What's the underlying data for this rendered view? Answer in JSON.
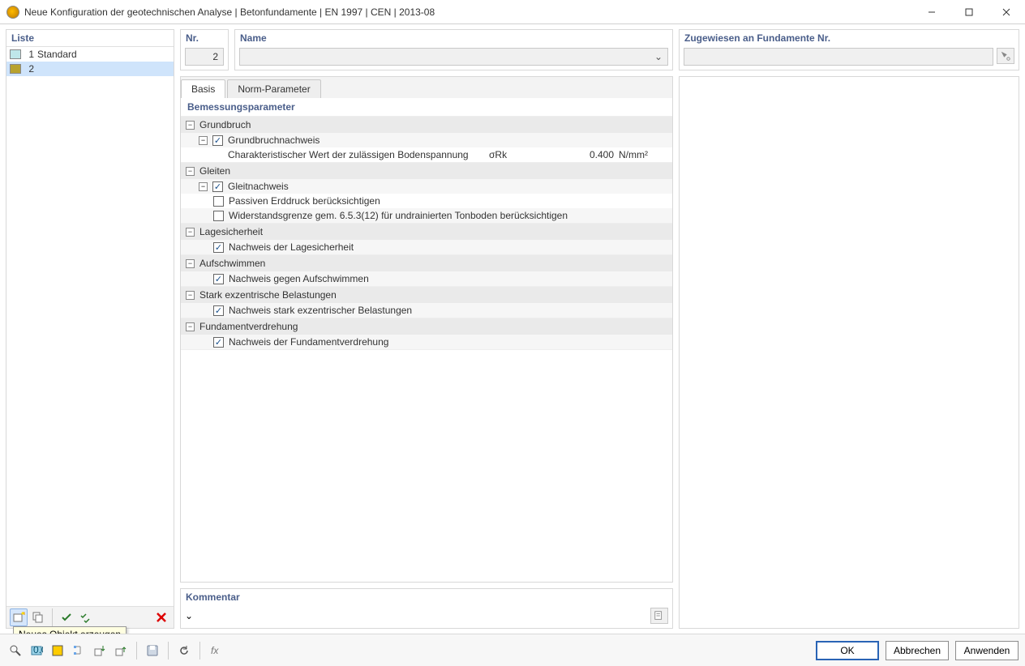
{
  "window": {
    "title": "Neue Konfiguration der geotechnischen Analyse | Betonfundamente | EN 1997 | CEN | 2013-08"
  },
  "list": {
    "header": "Liste",
    "items": [
      {
        "num": "1",
        "name": "Standard",
        "color": "#bfe7ea"
      },
      {
        "num": "2",
        "name": "",
        "color": "#b8a22e"
      }
    ]
  },
  "tooltip": "Neues Objekt erzeugen",
  "fields": {
    "nr_label": "Nr.",
    "nr_value": "2",
    "name_label": "Name",
    "name_value": "",
    "assigned_label": "Zugewiesen an Fundamente Nr.",
    "assigned_value": ""
  },
  "tabs": {
    "basis": "Basis",
    "norm": "Norm-Parameter"
  },
  "params": {
    "header": "Bemessungsparameter",
    "groups": [
      {
        "title": "Grundbruch",
        "items": [
          {
            "type": "check",
            "checked": true,
            "label": "Grundbruchnachweis",
            "hasSub": true
          },
          {
            "type": "value",
            "desc": "Charakteristischer Wert der zulässigen Bodenspannung",
            "sym": "σRk",
            "val": "0.400",
            "unit": "N/mm²"
          }
        ]
      },
      {
        "title": "Gleiten",
        "items": [
          {
            "type": "check",
            "checked": true,
            "label": "Gleitnachweis",
            "hasSub": true
          },
          {
            "type": "check",
            "checked": false,
            "label": "Passiven Erddruck berücksichtigen"
          },
          {
            "type": "check",
            "checked": false,
            "label": "Widerstandsgrenze gem. 6.5.3(12) für undrainierten Tonboden berücksichtigen"
          }
        ]
      },
      {
        "title": "Lagesicherheit",
        "items": [
          {
            "type": "check",
            "checked": true,
            "label": "Nachweis der Lagesicherheit"
          }
        ]
      },
      {
        "title": "Aufschwimmen",
        "items": [
          {
            "type": "check",
            "checked": true,
            "label": "Nachweis gegen Aufschwimmen"
          }
        ]
      },
      {
        "title": "Stark exzentrische Belastungen",
        "items": [
          {
            "type": "check",
            "checked": true,
            "label": "Nachweis stark exzentrischer Belastungen"
          }
        ]
      },
      {
        "title": "Fundamentverdrehung",
        "items": [
          {
            "type": "check",
            "checked": true,
            "label": "Nachweis der Fundamentverdrehung"
          }
        ]
      }
    ]
  },
  "comment": {
    "label": "Kommentar",
    "value": ""
  },
  "buttons": {
    "ok": "OK",
    "cancel": "Abbrechen",
    "apply": "Anwenden"
  }
}
